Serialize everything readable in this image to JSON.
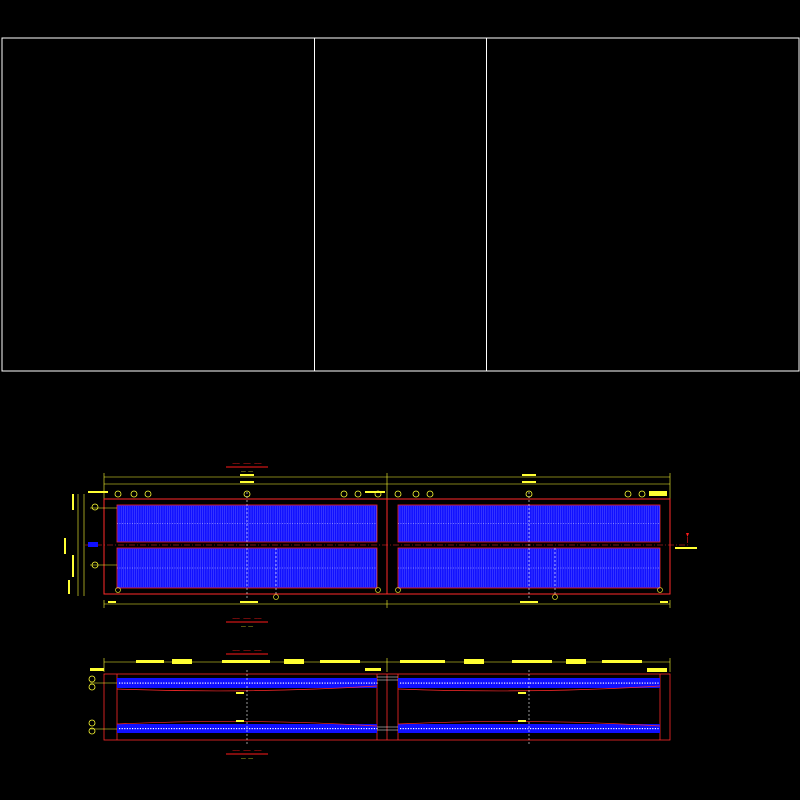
{
  "colors": {
    "background": "#000000",
    "frame": "#ffffff",
    "beam_fill": "#1010ff",
    "beam_edge": "#5a5aff",
    "outline": "#ff2a2a",
    "dim_line": "#ffff33",
    "label_red": "#ff1a1a",
    "center_line": "#ffffff"
  },
  "frame": {
    "panels": 3
  },
  "upper_plan": {
    "title": "—— —— ——",
    "scale": "—— ——",
    "bubbles": [
      "①",
      "①",
      "②",
      "②",
      "②",
      "③",
      "③",
      "①",
      "①",
      "②",
      "②",
      "③"
    ]
  },
  "middle_title": {
    "title": "—— —— ——",
    "scale": "—— ——"
  },
  "lower_plan": {
    "title": "—— —— ——",
    "scale": "—— ——"
  }
}
